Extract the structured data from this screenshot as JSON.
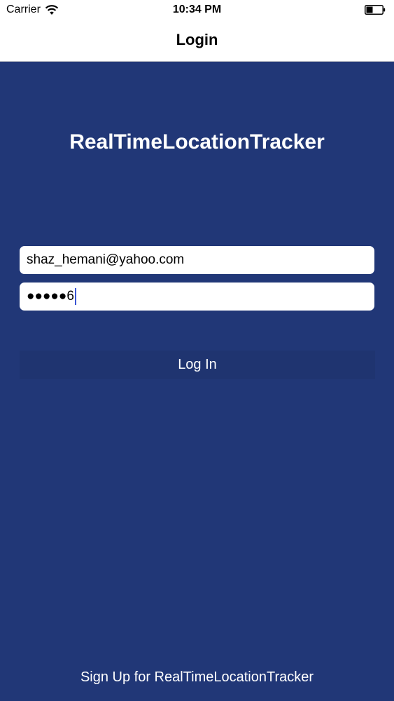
{
  "status_bar": {
    "carrier": "Carrier",
    "time": "10:34 PM",
    "wifi_icon": "wifi-icon",
    "battery_icon": "battery-icon"
  },
  "nav": {
    "title": "Login"
  },
  "app": {
    "title": "RealTimeLocationTracker"
  },
  "form": {
    "email_value": "shaz_hemani@yahoo.com",
    "password_masked": "●●●●●",
    "password_last_char": "6",
    "login_label": "Log In"
  },
  "footer": {
    "signup_label": "Sign Up for RealTimeLocationTracker"
  },
  "colors": {
    "background": "#213777",
    "button": "#1f3470",
    "caret": "#3a56d4"
  }
}
